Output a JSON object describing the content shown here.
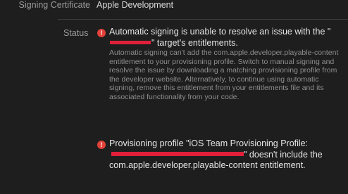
{
  "signing": {
    "label": "Signing Certificate",
    "value": "Apple Development"
  },
  "status": {
    "label": "Status",
    "issues": [
      {
        "icon": "error-icon",
        "title_prefix": "Automatic signing is unable to resolve an issue with the \"",
        "title_suffix": "\" target's entitlements.",
        "description": "Automatic signing can't add the com.apple.developer.playable-content entitlement to your provisioning profile. Switch to manual signing and resolve the issue by downloading a matching provisioning profile from the developer website. Alternatively, to continue using automatic signing, remove this entitlement from your entitlements file and its associated functionality from your code."
      },
      {
        "icon": "error-icon",
        "title_prefix": "Provisioning profile \"iOS Team Provisioning Profile:",
        "title_suffix": "\" doesn't include the com.apple.developer.playable-content entitlement."
      }
    ]
  },
  "colors": {
    "background": "#1e1e1e",
    "error": "#e2413a",
    "redaction": "#e0203a"
  }
}
